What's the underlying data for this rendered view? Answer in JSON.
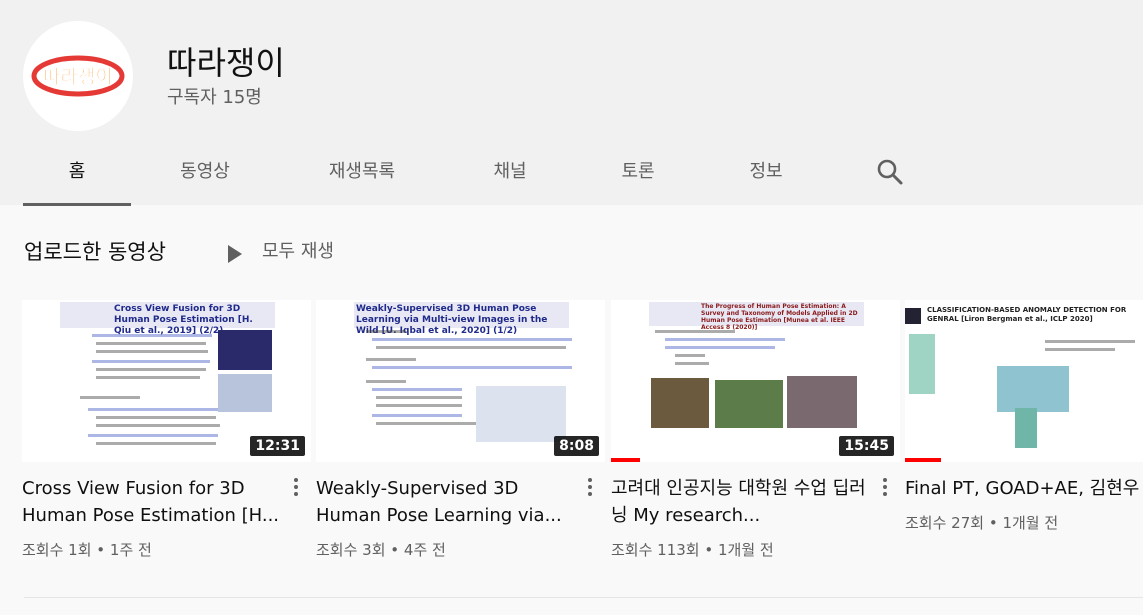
{
  "channel": {
    "name": "따라쟁이",
    "subscribers": "구독자 15명",
    "logo_text": "따라쟁이",
    "accent_color": "#e53935"
  },
  "tabs": [
    {
      "label": "홈",
      "active": true
    },
    {
      "label": "동영상",
      "active": false
    },
    {
      "label": "재생목록",
      "active": false
    },
    {
      "label": "채널",
      "active": false
    },
    {
      "label": "토론",
      "active": false
    },
    {
      "label": "정보",
      "active": false
    }
  ],
  "search_icon": "search-icon",
  "section": {
    "title": "업로드한 동영상",
    "play_all": "모두 재생"
  },
  "videos": [
    {
      "title": "Cross View Fusion for 3D Human Pose Estimation [H...",
      "views": "조회수 1회",
      "age": "1주 전",
      "duration": "12:31",
      "thumb_title": "Cross View Fusion for 3D Human Pose Estimation [H. Qiu et al., 2019] (2/2)",
      "progress": 0
    },
    {
      "title": "Weakly-Supervised 3D Human Pose Learning via...",
      "views": "조회수 3회",
      "age": "4주 전",
      "duration": "8:08",
      "thumb_title": "Weakly-Supervised 3D Human Pose Learning via Multi-view Images in the Wild [U. Iqbal et al., 2020] (1/2)",
      "progress": 0
    },
    {
      "title": "고려대 인공지능 대학원 수업 딥러닝 My research...",
      "views": "조회수 113회",
      "age": "1개월 전",
      "duration": "15:45",
      "thumb_title": "The Progress of Human Pose Estimation: A Survey and Taxonomy of Models Applied in 2D Human Pose Estimation [Munea et al. IEEE Access 8 (2020)]",
      "progress": 0.1
    },
    {
      "title": "Final PT, GOAD+AE, 김현우",
      "views": "조회수 27회",
      "age": "1개월 전",
      "duration": "",
      "thumb_title": "CLASSIFICATION-BASED ANOMALY DETECTION FOR GENRAL [Liron Bergman et al., ICLP 2020]",
      "progress": 0.15
    }
  ]
}
